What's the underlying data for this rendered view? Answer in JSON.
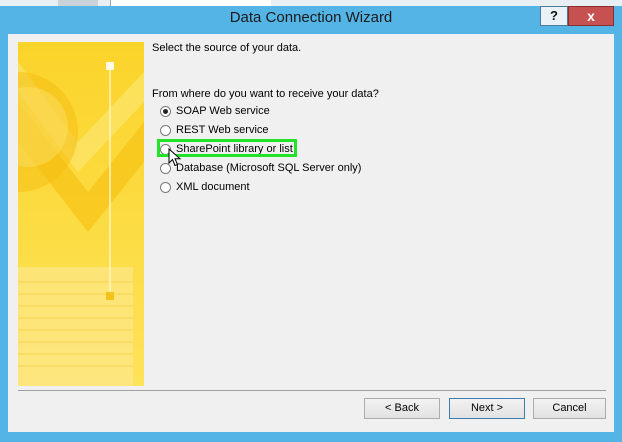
{
  "window": {
    "title": "Data Connection Wizard",
    "help_label": "?",
    "close_label": "x"
  },
  "content": {
    "subtitle": "Select the source of your data.",
    "prompt": "From where do you want to receive your data?",
    "options": [
      {
        "label": "SOAP Web service",
        "checked": true
      },
      {
        "label": "REST Web service",
        "checked": false
      },
      {
        "label": "SharePoint library or list",
        "checked": false
      },
      {
        "label": "Database (Microsoft SQL Server only)",
        "checked": false
      },
      {
        "label": "XML document",
        "checked": false
      }
    ]
  },
  "buttons": {
    "back": "< Back",
    "next": "Next >",
    "cancel": "Cancel"
  },
  "colors": {
    "titlebar": "#54b4e6",
    "highlight": "#22e22a",
    "art_yellow": "#f9d632"
  }
}
